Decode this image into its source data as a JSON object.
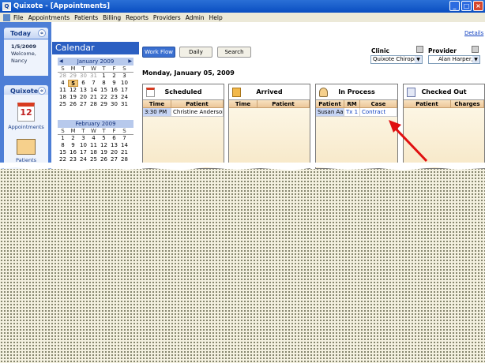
{
  "window": {
    "title": "Quixote - [Appointments]",
    "app_icon": "Q"
  },
  "menu": [
    "File",
    "Appointments",
    "Patients",
    "Billing",
    "Reports",
    "Providers",
    "Admin",
    "Help"
  ],
  "sidebar": {
    "today_header": "Today",
    "today_date": "1/5/2009",
    "welcome": "Welcome,",
    "user": "Nancy",
    "nav_header": "Quixote",
    "nav_items": [
      {
        "label": "Appointments",
        "icon_text": "12"
      },
      {
        "label": "Patients"
      }
    ]
  },
  "calendar": {
    "title": "Calendar",
    "months": [
      {
        "name": "January 2009",
        "days_of_week": [
          "S",
          "M",
          "T",
          "W",
          "T",
          "F",
          "S"
        ],
        "weeks": [
          [
            "28",
            "29",
            "30",
            "31",
            "1",
            "2",
            "3"
          ],
          [
            "4",
            "5",
            "6",
            "7",
            "8",
            "9",
            "10"
          ],
          [
            "11",
            "12",
            "13",
            "14",
            "15",
            "16",
            "17"
          ],
          [
            "18",
            "19",
            "20",
            "21",
            "22",
            "23",
            "24"
          ],
          [
            "25",
            "26",
            "27",
            "28",
            "29",
            "30",
            "31"
          ]
        ]
      },
      {
        "name": "February 2009",
        "days_of_week": [
          "S",
          "M",
          "T",
          "W",
          "T",
          "F",
          "S"
        ],
        "weeks": [
          [
            "1",
            "2",
            "3",
            "4",
            "5",
            "6",
            "7"
          ],
          [
            "8",
            "9",
            "10",
            "11",
            "12",
            "13",
            "14"
          ],
          [
            "15",
            "16",
            "17",
            "18",
            "19",
            "20",
            "21"
          ],
          [
            "22",
            "23",
            "24",
            "25",
            "26",
            "27",
            "28"
          ]
        ]
      }
    ],
    "today": "5"
  },
  "toolbar": {
    "work_flow": "Work Flow",
    "daily": "Daily",
    "search": "Search",
    "details": "Details"
  },
  "filters": {
    "clinic_label": "Clinic",
    "clinic_value": "Quixote Chiroprac",
    "provider_label": "Provider",
    "provider_value": "Alan Harper,"
  },
  "date_label": "Monday, January 05, 2009",
  "columns": {
    "scheduled": {
      "title": "Scheduled",
      "headers": [
        "Time",
        "Patient"
      ],
      "rows": [
        [
          "3:30 PM",
          "Christine Anderson"
        ]
      ]
    },
    "arrived": {
      "title": "Arrived",
      "headers": [
        "Time",
        "Patient"
      ],
      "rows": []
    },
    "in_process": {
      "title": "In Process",
      "headers": [
        "Patient",
        "RM",
        "Case"
      ],
      "rows": [
        [
          "Susan Aar",
          "Tx 1",
          "Contract"
        ]
      ]
    },
    "checked_out": {
      "title": "Checked Out",
      "headers": [
        "Patient",
        "Charges"
      ],
      "rows": []
    }
  },
  "colors": {
    "title_bar": "#0a4ec1",
    "sidebar": "#4d7ed6",
    "annotation_arrow": "#e01010",
    "grid_header": "#ecc79a"
  }
}
